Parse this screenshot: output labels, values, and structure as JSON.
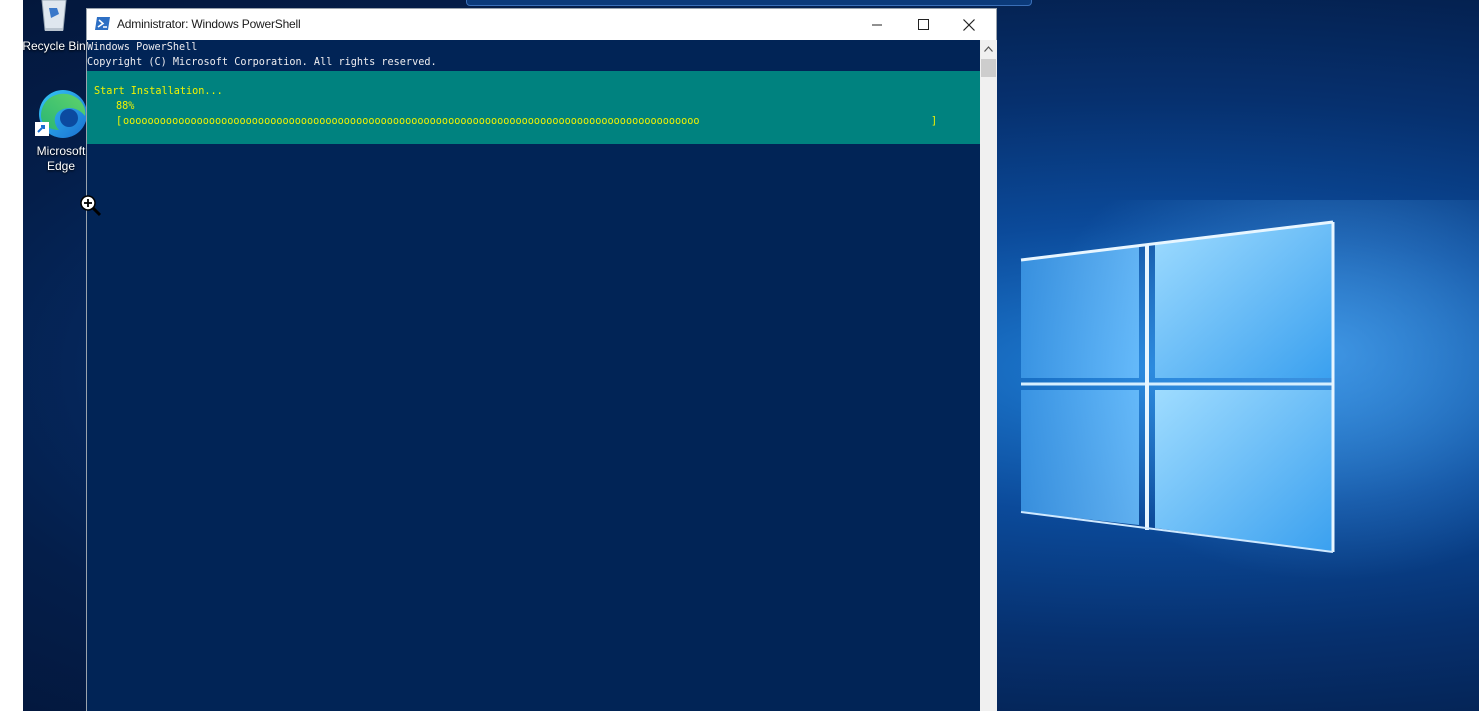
{
  "desktop": {
    "icons": [
      {
        "label": "Recycle Bin",
        "icon": "recycle-bin-icon"
      },
      {
        "label": "Microsoft Edge",
        "label_line1": "Microsoft",
        "label_line2": "Edge",
        "icon": "edge-icon"
      }
    ],
    "wallpaper": "windows-10-hero",
    "colors": {
      "wallpaper_dark": "#03173c",
      "wallpaper_light": "#1f7fd6"
    }
  },
  "window": {
    "title": "Administrator: Windows PowerShell",
    "icon": "powershell-icon",
    "controls": {
      "minimize_icon": "minimize-icon",
      "maximize_icon": "maximize-icon",
      "close_icon": "close-icon"
    }
  },
  "console": {
    "lines": [
      "Windows PowerShell",
      "Copyright (C) Microsoft Corporation. All rights reserved."
    ],
    "progress": {
      "activity": "Start Installation...",
      "percent_label": "88%",
      "percent": 88,
      "bar_open": "[",
      "bar_fill": "oooooooooooooooooooooooooooooooooooooooooooooooooooooooooooooooooooooooooooooooooooooooooooooo",
      "bar_close": "]"
    },
    "colors": {
      "background": "#012456",
      "progress_background": "#00827f",
      "progress_text": "#f2f200",
      "text": "#eeedf0"
    }
  },
  "cursor": {
    "icon": "zoom-in-cursor-icon"
  }
}
